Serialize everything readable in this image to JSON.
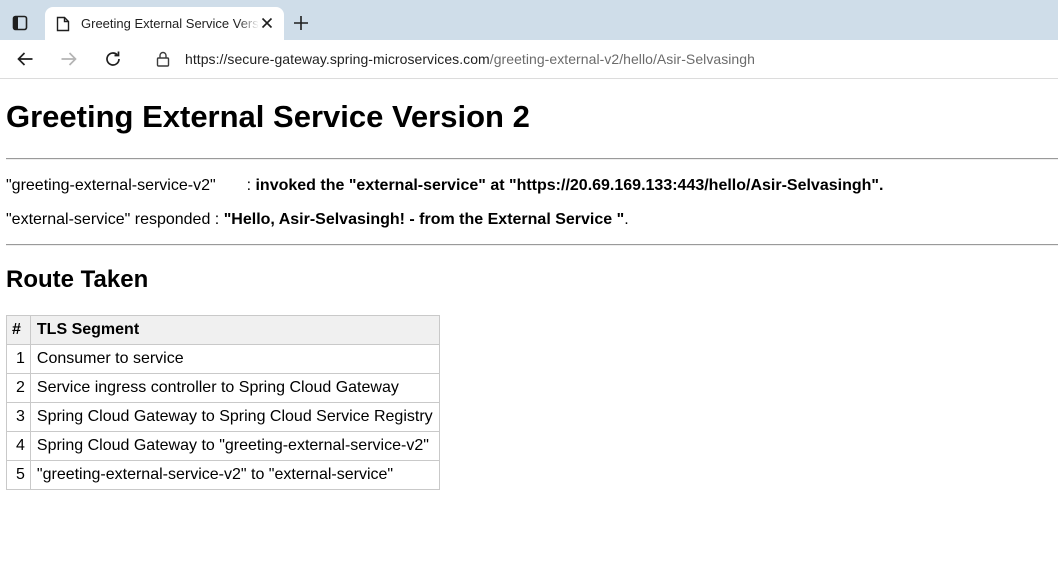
{
  "browser": {
    "tab": {
      "title": "Greeting External Service Version 2"
    },
    "address": {
      "host": "https://secure-gateway.spring-microservices.com",
      "path": "/greeting-external-v2/hello/Asir-Selvasingh"
    }
  },
  "page": {
    "title": "Greeting External Service Version 2",
    "invocation": {
      "service": "\"greeting-external-service-v2\"",
      "separator": ":",
      "text": "invoked the \"external-service\" at \"https://20.69.169.133:443/hello/Asir-Selvasingh\"."
    },
    "response": {
      "prefix": "\"external-service\" responded :",
      "message": "\"Hello, Asir-Selvasingh! - from the External Service \"",
      "suffix": "."
    },
    "route_heading": "Route Taken",
    "table": {
      "headers": [
        "#",
        "TLS Segment"
      ],
      "rows": [
        {
          "num": "1",
          "segment": "Consumer to service"
        },
        {
          "num": "2",
          "segment": "Service ingress controller to Spring Cloud Gateway"
        },
        {
          "num": "3",
          "segment": "Spring Cloud Gateway to Spring Cloud Service Registry"
        },
        {
          "num": "4",
          "segment": "Spring Cloud Gateway to \"greeting-external-service-v2\""
        },
        {
          "num": "5",
          "segment": "\"greeting-external-service-v2\" to \"external-service\""
        }
      ]
    }
  },
  "icons": {
    "tab_actions": "tab-actions-icon",
    "favicon": "page-icon",
    "close": "close-icon",
    "new_tab": "plus-icon",
    "back": "back-arrow-icon",
    "forward": "forward-arrow-icon",
    "reload": "reload-icon",
    "lock": "lock-icon"
  },
  "colors": {
    "tabstrip": "#cfdde9",
    "table_header": "#f0f0f0",
    "url_path": "#6b6b6b"
  }
}
